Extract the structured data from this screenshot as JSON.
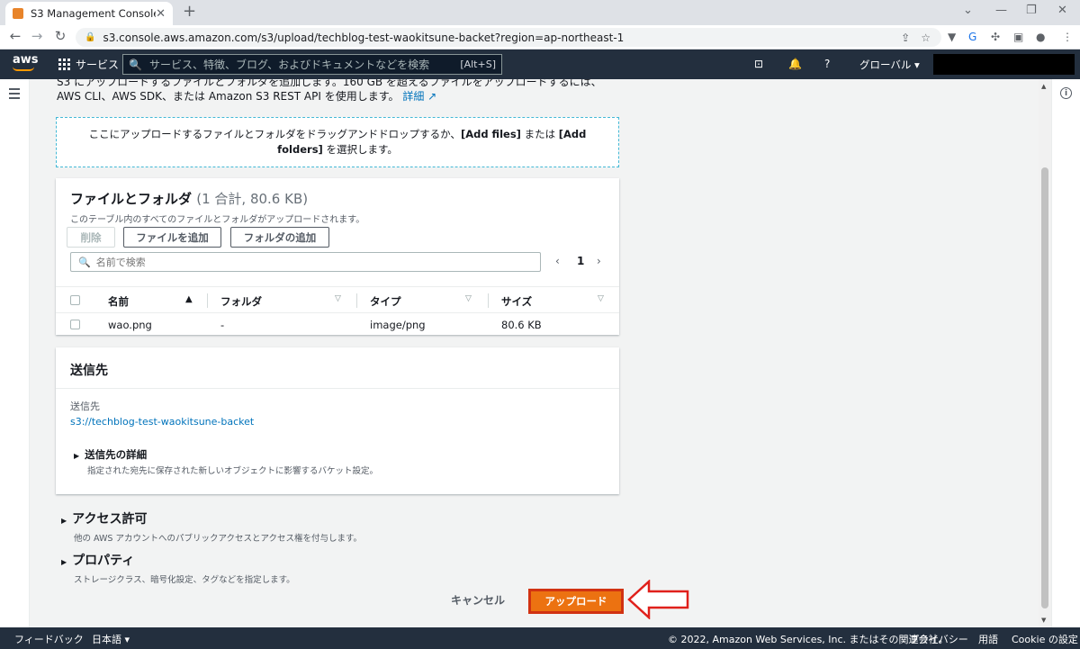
{
  "browser": {
    "tab_title": "S3 Management Console",
    "url": "s3.console.aws.amazon.com/s3/upload/techblog-test-waokitsune-backet?region=ap-northeast-1"
  },
  "aws_header": {
    "logo": "aws",
    "services_label": "サービス",
    "search_placeholder": "サービス、特徴、ブログ、およびドキュメントなどを検索",
    "search_shortcut": "[Alt+S]",
    "region_label": "グローバル ▾"
  },
  "intro": {
    "text": "S3 にアップロードするファイルとフォルダを追加します。160 GB を超えるファイルをアップロードするには、AWS CLI、AWS SDK、または Amazon S3 REST API を使用します。",
    "link": "詳細"
  },
  "dropzone": {
    "text_before": "ここにアップロードするファイルとフォルダをドラッグアンドドロップするか、",
    "add_files": "[Add files]",
    "text_middle": " または ",
    "add_folders": "[Add folders]",
    "text_after": " を選択します。"
  },
  "files": {
    "title": "ファイルとフォルダ",
    "count": "(1 合計, 80.6 KB)",
    "description": "このテーブル内のすべてのファイルとフォルダがアップロードされます。",
    "delete_label": "削除",
    "add_files_label": "ファイルを追加",
    "add_folder_label": "フォルダの追加",
    "search_placeholder": "名前で検索",
    "page": "1",
    "columns": [
      "名前",
      "フォルダ",
      "タイプ",
      "サイズ"
    ],
    "rows": [
      {
        "name": "wao.png",
        "folder": "-",
        "type": "image/png",
        "size": "80.6 KB"
      }
    ]
  },
  "destination": {
    "title": "送信先",
    "label": "送信先",
    "link": "s3://techblog-test-waokitsune-backet",
    "details_title": "送信先の詳細",
    "details_desc": "指定された宛先に保存された新しいオブジェクトに影響するバケット設定。"
  },
  "access": {
    "title": "アクセス許可",
    "desc": "他の AWS アカウントへのパブリックアクセスとアクセス権を付与します。"
  },
  "properties": {
    "title": "プロパティ",
    "desc": "ストレージクラス、暗号化設定、タグなどを指定します。"
  },
  "actions": {
    "cancel": "キャンセル",
    "upload": "アップロード"
  },
  "footer": {
    "feedback": "フィードバック",
    "language": "日本語 ▾",
    "copyright": "© 2022, Amazon Web Services, Inc. またはその関連会社。",
    "privacy": "プライバシー",
    "terms": "用語",
    "cookies": "Cookie の設定"
  },
  "colors": {
    "aws_navy": "#232f3e",
    "upload_orange": "#ec7211",
    "highlight_red": "#e0201b",
    "link_blue": "#0073bb"
  }
}
